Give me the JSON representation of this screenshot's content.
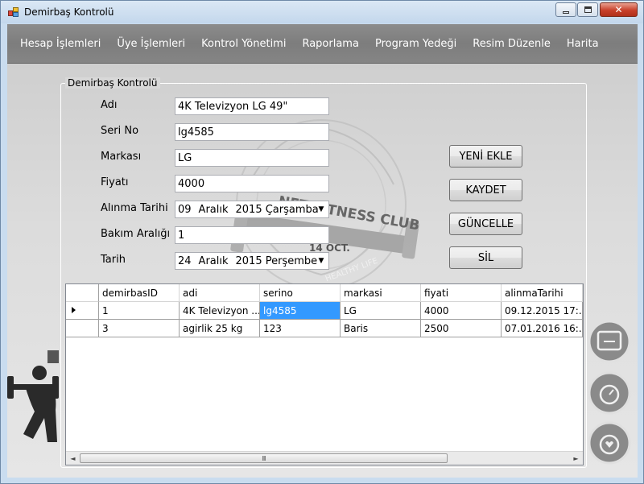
{
  "window": {
    "title": "Demirbaş Kontrolü",
    "close_glyph": "✕"
  },
  "menu": {
    "items": [
      "Hesap İşlemleri",
      "Üye İşlemleri",
      "Kontrol Yönetimi",
      "Raporlama",
      "Program Yedeği",
      "Resim Düzenle",
      "Harita"
    ]
  },
  "background_logo": {
    "text": "NET FITNESS CLUB",
    "date": "14 OCT.",
    "tagline": "HEALTHY LIFE"
  },
  "form": {
    "group_title": "Demirbaş Kontrolü",
    "fields": {
      "adi": {
        "label": "Adı",
        "value": "4K Televizyon LG 49\""
      },
      "seri_no": {
        "label": "Seri No",
        "value": "lg4585"
      },
      "markasi": {
        "label": "Markası",
        "value": "LG"
      },
      "fiyati": {
        "label": "Fiyatı",
        "value": "4000"
      },
      "alinma_tarihi": {
        "label": "Alınma Tarihi",
        "day": "09",
        "month": "Aralık",
        "year_weekday": "2015 Çarşamba"
      },
      "bakim_araligi": {
        "label": "Bakım Aralığı",
        "value": "1"
      },
      "tarih": {
        "label": "Tarih",
        "day": "24",
        "month": "Aralık",
        "year_weekday": "2015 Perşembe"
      }
    },
    "buttons": {
      "yeni_ekle": "YENİ EKLE",
      "kaydet": "KAYDET",
      "guncelle": "GÜNCELLE",
      "sil": "SİL"
    }
  },
  "grid": {
    "columns": [
      "demirbasID",
      "adi",
      "serino",
      "markasi",
      "fiyati",
      "alinmaTarihi"
    ],
    "rows": [
      [
        "1",
        "4K Televizyon ...",
        "lg4585",
        "LG",
        "4000",
        "09.12.2015 17:..."
      ],
      [
        "3",
        "agirlik 25 kg",
        "123",
        "Baris",
        "2500",
        "07.01.2016 16:..."
      ]
    ],
    "selected_row": 0,
    "selected_column": 2,
    "scroll_left_glyph": "◄",
    "scroll_right_glyph": "►",
    "scroll_thumb_grip": "III"
  },
  "colors": {
    "menubar": "#858585",
    "selection": "#3399ff"
  },
  "icons": [
    "app-icon",
    "dropdown-arrow-icon",
    "row-pointer-icon",
    "scale-icon",
    "stopwatch-icon",
    "heart-timer-icon",
    "gym-silhouette-icon"
  ]
}
